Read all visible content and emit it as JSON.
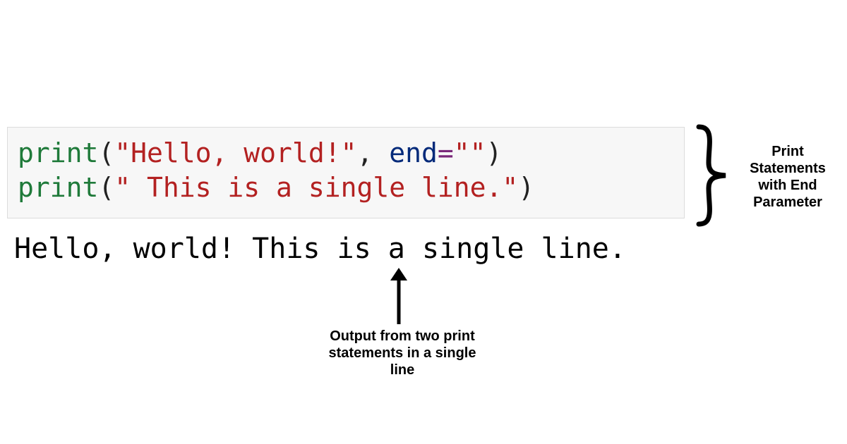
{
  "code": {
    "line1": {
      "fn": "print",
      "open": "(",
      "str": "\"Hello, world!\"",
      "comma": ", ",
      "kw": "end",
      "op": "=",
      "val": "\"\"",
      "close": ")"
    },
    "line2": {
      "fn": "print",
      "open": "(",
      "str": "\" This is a single line.\"",
      "close": ")"
    }
  },
  "output": "Hello, world! This is a single line.",
  "annotations": {
    "right": "Print Statements with End Parameter",
    "bottom": "Output from two print statements in a single line"
  },
  "colors": {
    "code_background": "#f7f7f7",
    "code_border": "#dcdcdc",
    "fn": "#1f7a3a",
    "str": "#b32121",
    "kw": "#042a7a",
    "op": "#7a287a",
    "annotation": "#000000"
  }
}
